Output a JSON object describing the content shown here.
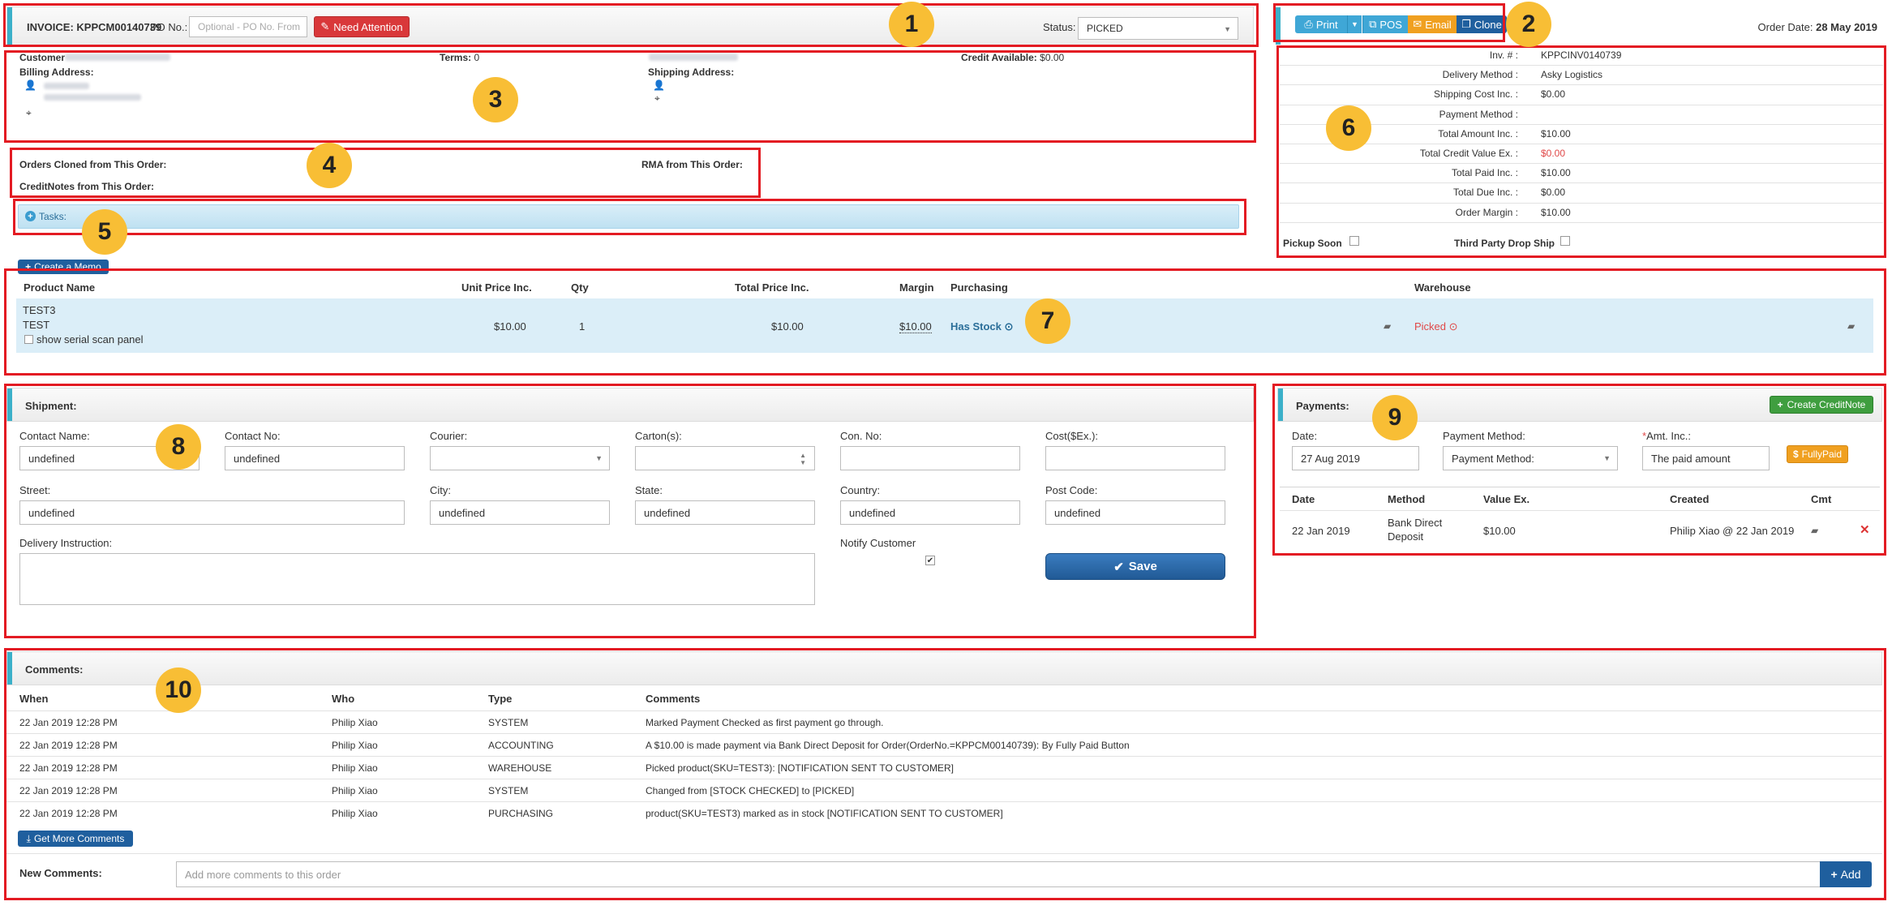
{
  "invoice": {
    "label": "INVOICE:",
    "number": "KPPCM00140739",
    "po_label": "PO No.:",
    "po_placeholder": "Optional - PO No. From",
    "need_attention": "Need Attention",
    "status_label": "Status:",
    "status_value": "PICKED"
  },
  "toolbar": {
    "print": "Print",
    "pos": "POS",
    "email": "Email",
    "clone": "Clone",
    "order_date_label": "Order Date:",
    "order_date": "28 May 2019"
  },
  "customer": {
    "customer_label": "Customer",
    "terms_label": "Terms:",
    "terms_value": "0",
    "credit_label": "Credit Available:",
    "credit_value": "$0.00",
    "billing_label": "Billing Address:",
    "shipping_label": "Shipping Address:"
  },
  "relations": {
    "cloned_label": "Orders Cloned from This Order:",
    "rma_label": "RMA from This Order:",
    "creditnotes_label": "CreditNotes from This Order:"
  },
  "tasks": {
    "label": "Tasks:"
  },
  "summary": {
    "rows": [
      {
        "label": "Inv. # :",
        "value": "KPPCINV0140739"
      },
      {
        "label": "Delivery Method :",
        "value": "Asky Logistics"
      },
      {
        "label": "Shipping Cost Inc. :",
        "value": "$0.00"
      },
      {
        "label": "Payment Method :",
        "value": ""
      },
      {
        "label": "Total Amount Inc. :",
        "value": "$10.00"
      },
      {
        "label": "Total Credit Value Ex. :",
        "value": "$0.00"
      },
      {
        "label": "Total Paid Inc. :",
        "value": "$10.00"
      },
      {
        "label": "Total Due Inc. :",
        "value": "$0.00"
      },
      {
        "label": "Order Margin :",
        "value": "$10.00"
      }
    ],
    "pickup_soon": "Pickup Soon",
    "third_party": "Third Party Drop Ship"
  },
  "products": {
    "create_memo": "Create a Memo",
    "headers": [
      "Product Name",
      "Unit Price Inc.",
      "Qty",
      "Total Price Inc.",
      "Margin",
      "Purchasing",
      "Warehouse"
    ],
    "row": {
      "sku": "TEST3",
      "name": "TEST",
      "serial": "show serial scan panel",
      "unit_price": "$10.00",
      "qty": "1",
      "total": "$10.00",
      "margin": "$10.00",
      "purchasing": "Has Stock",
      "warehouse": "Picked"
    }
  },
  "shipment": {
    "title": "Shipment:",
    "contact_name_label": "Contact Name:",
    "contact_name": "undefined",
    "contact_no_label": "Contact No:",
    "contact_no": "undefined",
    "courier_label": "Courier:",
    "cartons_label": "Carton(s):",
    "con_no_label": "Con. No:",
    "cost_label": "Cost($Ex.):",
    "street_label": "Street:",
    "street": "undefined",
    "city_label": "City:",
    "city": "undefined",
    "state_label": "State:",
    "state": "undefined",
    "country_label": "Country:",
    "country": "undefined",
    "postcode_label": "Post Code:",
    "postcode": "undefined",
    "delivery_label": "Delivery Instruction:",
    "notify_label": "Notify Customer",
    "save": "Save"
  },
  "payments": {
    "title": "Payments:",
    "create_credit": "Create CreditNote",
    "date_label": "Date:",
    "date_value": "27 Aug 2019",
    "method_label": "Payment Method:",
    "method_value": "Payment Method:",
    "amt_label": "Amt. Inc.:",
    "amt_placeholder": "The paid amount",
    "fully_paid": "FullyPaid",
    "headers": [
      "Date",
      "Method",
      "Value Ex.",
      "Created",
      "Cmt"
    ],
    "row": {
      "date": "22 Jan 2019",
      "method_line1": "Bank Direct",
      "method_line2": "Deposit",
      "value": "$10.00",
      "created": "Philip Xiao @ 22 Jan 2019"
    }
  },
  "comments": {
    "title": "Comments:",
    "headers": [
      "When",
      "Who",
      "Type",
      "Comments"
    ],
    "rows": [
      {
        "when": "22 Jan 2019 12:28 PM",
        "who": "Philip Xiao",
        "type": "SYSTEM",
        "text": "Marked Payment Checked as first payment go through."
      },
      {
        "when": "22 Jan 2019 12:28 PM",
        "who": "Philip Xiao",
        "type": "ACCOUNTING",
        "text": "A $10.00 is made payment via Bank Direct Deposit for Order(OrderNo.=KPPCM00140739): By Fully Paid Button"
      },
      {
        "when": "22 Jan 2019 12:28 PM",
        "who": "Philip Xiao",
        "type": "WAREHOUSE",
        "text": "Picked product(SKU=TEST3): [NOTIFICATION SENT TO CUSTOMER]"
      },
      {
        "when": "22 Jan 2019 12:28 PM",
        "who": "Philip Xiao",
        "type": "SYSTEM",
        "text": "Changed from [STOCK CHECKED] to [PICKED]"
      },
      {
        "when": "22 Jan 2019 12:28 PM",
        "who": "Philip Xiao",
        "type": "PURCHASING",
        "text": "product(SKU=TEST3) marked as in stock [NOTIFICATION SENT TO CUSTOMER]"
      }
    ],
    "get_more": "Get More Comments",
    "new_label": "New Comments:",
    "new_placeholder": "Add more comments to this order",
    "add": "Add"
  },
  "markers": [
    "1",
    "2",
    "3",
    "4",
    "5",
    "6",
    "7",
    "8",
    "9",
    "10"
  ]
}
